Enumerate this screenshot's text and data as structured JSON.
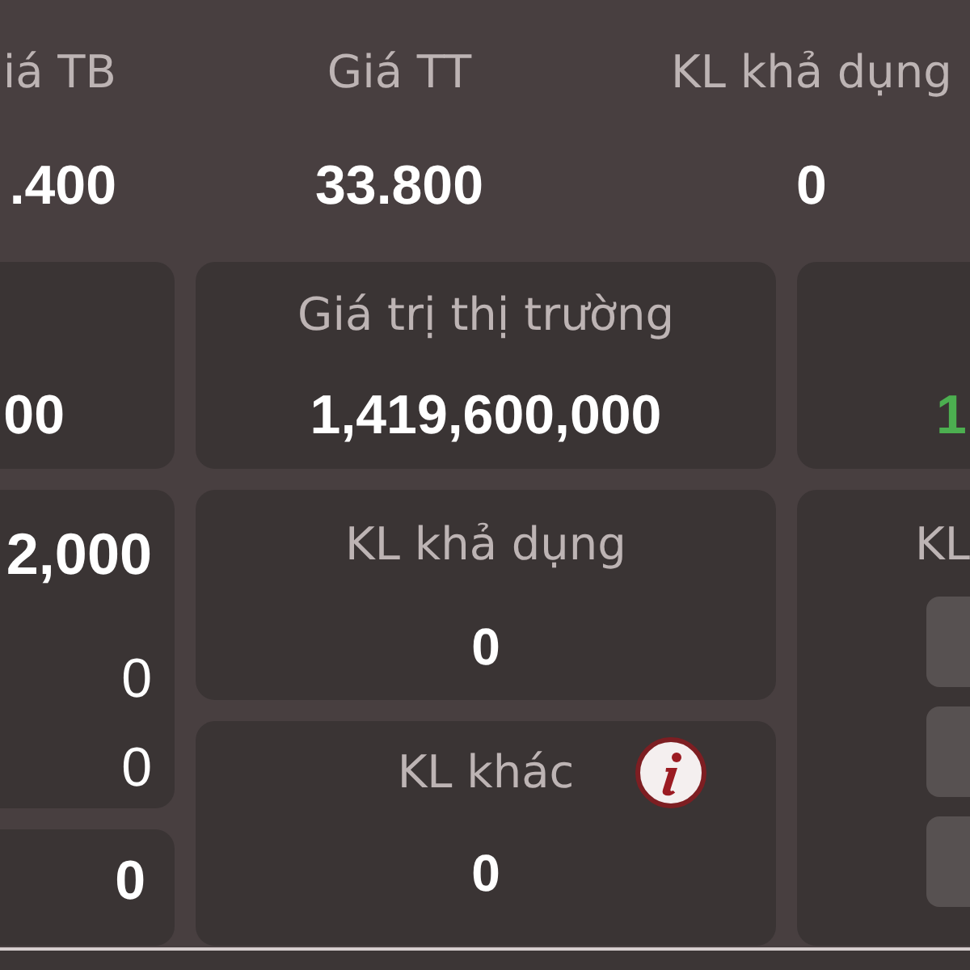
{
  "summary": [
    {
      "label": "iá TB",
      "value": ".400"
    },
    {
      "label": "Giá TT",
      "value": "33.800"
    },
    {
      "label": "KL khả dụng",
      "value": "0"
    }
  ],
  "market_row": [
    {
      "value": "00",
      "color": "#ffffff"
    },
    {
      "label": "Giá trị thị trường",
      "value": "1,419,600,000",
      "color": "#ffffff"
    },
    {
      "value": "1",
      "color": "#4caf50"
    }
  ],
  "left_panel": {
    "headline": "2,000",
    "values": [
      "0",
      "0"
    ]
  },
  "left_footer": {
    "value": "0"
  },
  "center_cards": [
    {
      "label": "KL khả dụng",
      "value": "0",
      "info": false
    },
    {
      "label": "KL khác",
      "value": "0",
      "info": true
    }
  ],
  "right_panel": {
    "label": "KL",
    "fields": [
      {
        "kind": "field"
      },
      {
        "kind": "field"
      },
      {
        "kind": "field"
      }
    ]
  }
}
